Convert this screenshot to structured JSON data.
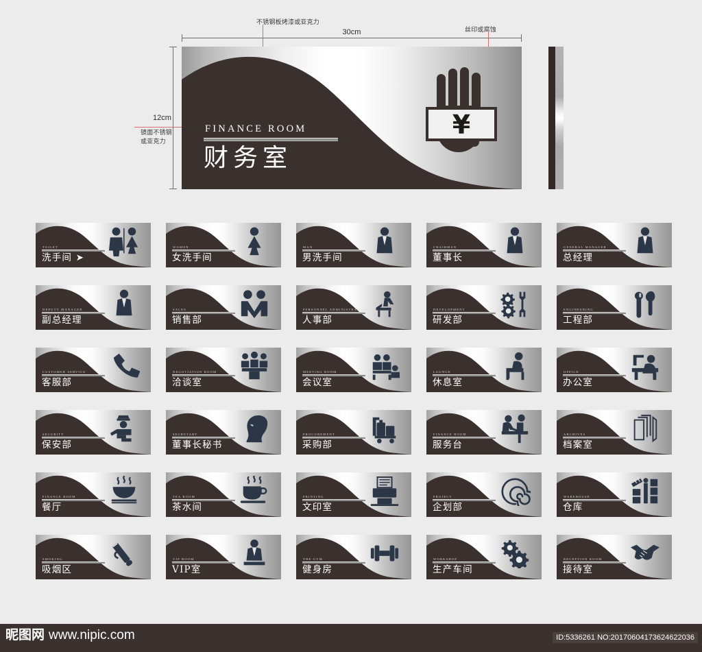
{
  "background_color": "#ececed",
  "sign_dark_color": "#3a302d",
  "annotation_color": "#d96c6c",
  "spec": {
    "annotation_top_left": "不锈钢板烤漆或亚克力",
    "annotation_top_right": "丝印或腐蚀",
    "annotation_left": "镜面不锈钢或亚克力",
    "width_label": "30cm",
    "height_label": "12cm"
  },
  "main_sign": {
    "english": "FINANCE ROOM",
    "chinese": "财务室",
    "icon": "hand-yen-icon"
  },
  "side_view": {
    "name": "sign-edge-profile"
  },
  "signs": [
    {
      "english": "TOILET",
      "chinese": "洗手间 ➤",
      "icon": "man-woman-icon"
    },
    {
      "english": "WOMEN",
      "chinese": "女洗手间",
      "icon": "woman-icon"
    },
    {
      "english": "MAN",
      "chinese": "男洗手间",
      "icon": "man-icon"
    },
    {
      "english": "CHAIRMAN",
      "chinese": "董事长",
      "icon": "suit-man-icon"
    },
    {
      "english": "GENERAL MANAGER",
      "chinese": "总经理",
      "icon": "suit-man-icon"
    },
    {
      "english": "DEPUTY MANAGER",
      "chinese": "副总经理",
      "icon": "suit-man-icon"
    },
    {
      "english": "SALES",
      "chinese": "销售部",
      "icon": "handshake-two-people-icon"
    },
    {
      "english": "PERSONNEL ADMINISTRATION",
      "chinese": "人事部",
      "icon": "person-at-desk-icon"
    },
    {
      "english": "DEVELOPMENT",
      "chinese": "研发部",
      "icon": "gears-wrench-icon"
    },
    {
      "english": "ENGINEERING",
      "chinese": "工程部",
      "icon": "wrench-screwdriver-icon"
    },
    {
      "english": "CUSTOMER SERVICE",
      "chinese": "客服部",
      "icon": "telephone-handset-icon"
    },
    {
      "english": "NEGOTIATION ROOM",
      "chinese": "洽谈室",
      "icon": "three-people-table-icon"
    },
    {
      "english": "MEETING ROOM",
      "chinese": "会议室",
      "icon": "meeting-people-screen-icon"
    },
    {
      "english": "LOUNGE",
      "chinese": "休息室",
      "icon": "seated-person-icon"
    },
    {
      "english": "OFFICE",
      "chinese": "办公室",
      "icon": "person-computer-desk-icon"
    },
    {
      "english": "SECURITY",
      "chinese": "保安部",
      "icon": "security-guard-icon"
    },
    {
      "english": "SECRETARY",
      "chinese": "董事长秘书",
      "icon": "woman-head-profile-icon"
    },
    {
      "english": "PROCUREMENT",
      "chinese": "采购部",
      "icon": "luggage-cart-icon"
    },
    {
      "english": "FINANCE ROOM",
      "chinese": "服务台",
      "icon": "reception-counter-icon"
    },
    {
      "english": "ARCHIVES",
      "chinese": "档案室",
      "icon": "stacked-files-icon"
    },
    {
      "english": "FINANCE ROOM",
      "chinese": "餐厅",
      "icon": "steaming-bowl-icon"
    },
    {
      "english": "TEA ROOM",
      "chinese": "茶水间",
      "icon": "steaming-cup-icon"
    },
    {
      "english": "PRINTING",
      "chinese": "文印室",
      "icon": "printer-icon"
    },
    {
      "english": "PROJECT",
      "chinese": "企划部",
      "icon": "spiral-icon"
    },
    {
      "english": "WAREHOUSE",
      "chinese": "仓库",
      "icon": "warehouse-shelves-icon"
    },
    {
      "english": "SMOKING",
      "chinese": "吸烟区",
      "icon": "cigarette-smoke-icon"
    },
    {
      "english": "VIP ROOM",
      "chinese": "VIP室",
      "icon": "vip-person-podium-icon"
    },
    {
      "english": "THE GYM",
      "chinese": "健身房",
      "icon": "dumbbell-icon"
    },
    {
      "english": "WORKSHOP",
      "chinese": "生产车间",
      "icon": "two-gears-icon"
    },
    {
      "english": "RECEPTION ROOM",
      "chinese": "接待室",
      "icon": "handshake-icon"
    }
  ],
  "footer": {
    "logo": "昵图网",
    "url": "www.nipic.com",
    "meta": "ID:5336261 NO:20170604173624622036"
  }
}
